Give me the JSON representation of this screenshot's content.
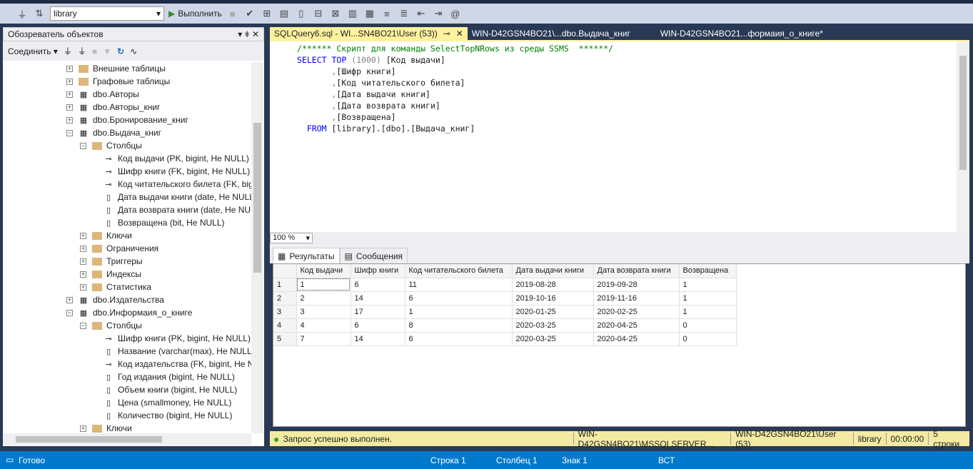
{
  "toolbar": {
    "database": "library",
    "execute_label": "Выполнить"
  },
  "object_explorer": {
    "title": "Обозреватель объектов",
    "connect_label": "Соединить",
    "tree": [
      {
        "label": "Внешние таблицы",
        "level": 0,
        "type": "folder",
        "exp": "+"
      },
      {
        "label": "Графовые таблицы",
        "level": 0,
        "type": "folder",
        "exp": "+"
      },
      {
        "label": "dbo.Авторы",
        "level": 0,
        "type": "table",
        "exp": "+"
      },
      {
        "label": "dbo.Авторы_книг",
        "level": 0,
        "type": "table",
        "exp": "+"
      },
      {
        "label": "dbo.Бронирование_книг",
        "level": 0,
        "type": "table",
        "exp": "+"
      },
      {
        "label": "dbo.Выдача_книг",
        "level": 0,
        "type": "table",
        "exp": "-"
      },
      {
        "label": "Столбцы",
        "level": 1,
        "type": "folder",
        "exp": "-"
      },
      {
        "label": "Код выдачи (PK, bigint, Не NULL)",
        "level": 2,
        "type": "pk"
      },
      {
        "label": "Шифр книги (FK, bigint, Не NULL)",
        "level": 2,
        "type": "fk"
      },
      {
        "label": "Код читательского билета (FK, big",
        "level": 2,
        "type": "fk"
      },
      {
        "label": "Дата выдачи книги (date, Не NULL",
        "level": 2,
        "type": "col"
      },
      {
        "label": "Дата возврата книги (date, Не NUL",
        "level": 2,
        "type": "col"
      },
      {
        "label": "Возвращена (bit, Не NULL)",
        "level": 2,
        "type": "col"
      },
      {
        "label": "Ключи",
        "level": 1,
        "type": "folder",
        "exp": "+"
      },
      {
        "label": "Ограничения",
        "level": 1,
        "type": "folder",
        "exp": "+"
      },
      {
        "label": "Триггеры",
        "level": 1,
        "type": "folder",
        "exp": "+"
      },
      {
        "label": "Индексы",
        "level": 1,
        "type": "folder",
        "exp": "+"
      },
      {
        "label": "Статистика",
        "level": 1,
        "type": "folder",
        "exp": "+"
      },
      {
        "label": "dbo.Издательства",
        "level": 0,
        "type": "table",
        "exp": "+"
      },
      {
        "label": "dbo.Информаия_о_книге",
        "level": 0,
        "type": "table",
        "exp": "-"
      },
      {
        "label": "Столбцы",
        "level": 1,
        "type": "folder",
        "exp": "-"
      },
      {
        "label": "Шифр книги (PK, bigint, Не NULL)",
        "level": 2,
        "type": "pk"
      },
      {
        "label": "Название (varchar(max), Не NULL)",
        "level": 2,
        "type": "col"
      },
      {
        "label": "Код издательства (FK, bigint, Не NU",
        "level": 2,
        "type": "fk"
      },
      {
        "label": "Год издания (bigint, Не NULL)",
        "level": 2,
        "type": "col"
      },
      {
        "label": "Объем книги (bigint, Не NULL)",
        "level": 2,
        "type": "col"
      },
      {
        "label": "Цена (smallmoney, Не NULL)",
        "level": 2,
        "type": "col"
      },
      {
        "label": "Количество (bigint, Не NULL)",
        "level": 2,
        "type": "col"
      },
      {
        "label": "Ключи",
        "level": 1,
        "type": "folder",
        "exp": "+"
      }
    ]
  },
  "tabs": [
    {
      "label": "SQLQuery6.sql - WI...SN4BO21\\User (53))",
      "active": true
    },
    {
      "label": "WIN-D42GSN4BO21\\...dbo.Выдача_книг"
    },
    {
      "label": "WIN-D42GSN4BO21...формаия_о_книге*"
    }
  ],
  "code": {
    "comment": "/****** Скрипт для команды SelectTopNRows из среды SSMS  ******/",
    "select": "SELECT",
    "top": "TOP",
    "n": "(1000)",
    "first_col": "[Код выдачи]",
    "cols": [
      "[Шифр книги]",
      "[Код читательского билета]",
      "[Дата выдачи книги]",
      "[Дата возврата книги]",
      "[Возвращена]"
    ],
    "from": "FROM",
    "source": "[library].[dbo].[Выдача_книг]"
  },
  "zoom": "100 %",
  "results": {
    "tabs": [
      "Результаты",
      "Сообщения"
    ],
    "columns": [
      "Код выдачи",
      "Шифр книги",
      "Код читательского билета",
      "Дата выдачи книги",
      "Дата возврата книги",
      "Возвращена"
    ],
    "rows": [
      [
        "1",
        "1",
        "6",
        "11",
        "2019-08-28",
        "2019-09-28",
        "1"
      ],
      [
        "2",
        "2",
        "14",
        "6",
        "2019-10-16",
        "2019-11-16",
        "1"
      ],
      [
        "3",
        "3",
        "17",
        "1",
        "2020-01-25",
        "2020-02-25",
        "1"
      ],
      [
        "4",
        "4",
        "6",
        "8",
        "2020-03-25",
        "2020-04-25",
        "0"
      ],
      [
        "5",
        "7",
        "14",
        "6",
        "2020-03-25",
        "2020-04-25",
        "0"
      ]
    ]
  },
  "query_status": {
    "message": "Запрос успешно выполнен.",
    "server": "WIN-D42GSN4BO21\\MSSQLSERVER...",
    "user": "WIN-D42GSN4BO21\\User (53)",
    "database": "library",
    "time": "00:00:00",
    "rows": "5 строки"
  },
  "statusbar": {
    "ready": "Готово",
    "line": "Строка 1",
    "column": "Столбец 1",
    "char": "Знак 1",
    "mode": "ВСТ"
  },
  "colors": {
    "accent": "#007acc",
    "active_tab": "#fff29d",
    "status_bg": "#f3eba3",
    "frame": "#293955"
  }
}
